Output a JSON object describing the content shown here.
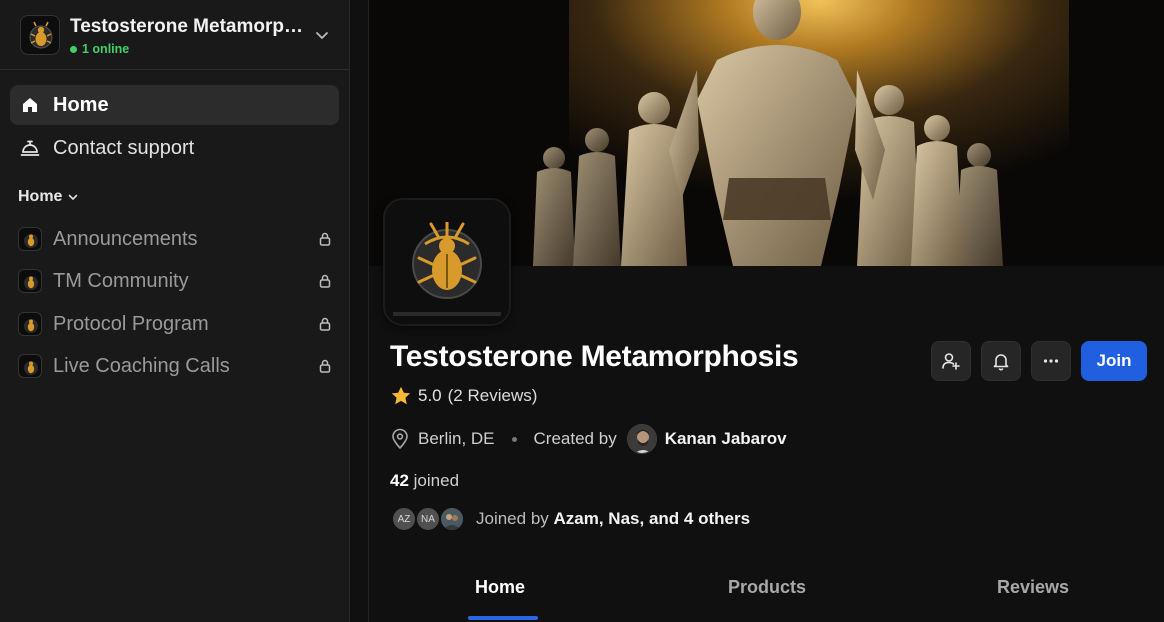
{
  "sidebar": {
    "app_title": "Testosterone Metamorphosis",
    "online_text": "1 online",
    "nav": [
      {
        "label": "Home",
        "icon": "home-icon",
        "active": true
      },
      {
        "label": "Contact support",
        "icon": "bell-desk-icon",
        "active": false
      }
    ],
    "section_title": "Home",
    "channels": [
      {
        "label": "Announcements",
        "icon": "beetle-logo-icon",
        "locked": true
      },
      {
        "label": "TM Community",
        "icon": "beetle-logo-icon",
        "locked": true
      },
      {
        "label": "Protocol Program",
        "icon": "beetle-logo-icon",
        "locked": true
      },
      {
        "label": "Live Coaching Calls",
        "icon": "beetle-logo-icon",
        "locked": true
      }
    ]
  },
  "group": {
    "title": "Testosterone Metamorphosis",
    "rating_score": "5.0",
    "rating_reviews": "(2 Reviews)",
    "location": "Berlin, DE",
    "created_by_label": "Created by",
    "creator_name": "Kanan Jabarov",
    "joined_count": "42",
    "joined_label": "joined",
    "joined_by_label": "Joined by",
    "joined_by_names": "Azam, Nas, and 4 others",
    "member_initials": [
      "AZ",
      "NA"
    ]
  },
  "actions": {
    "invite_icon": "add-user-icon",
    "notify_icon": "bell-icon",
    "more_icon": "more-horizontal-icon",
    "join_label": "Join"
  },
  "tabs": [
    {
      "label": "Home",
      "active": true
    },
    {
      "label": "Products",
      "active": false
    },
    {
      "label": "Reviews",
      "active": false
    }
  ],
  "colors": {
    "accent": "#1f5fe0",
    "online": "#3fcf6b",
    "star": "#f5b82e",
    "gold": "#d89a2a"
  }
}
